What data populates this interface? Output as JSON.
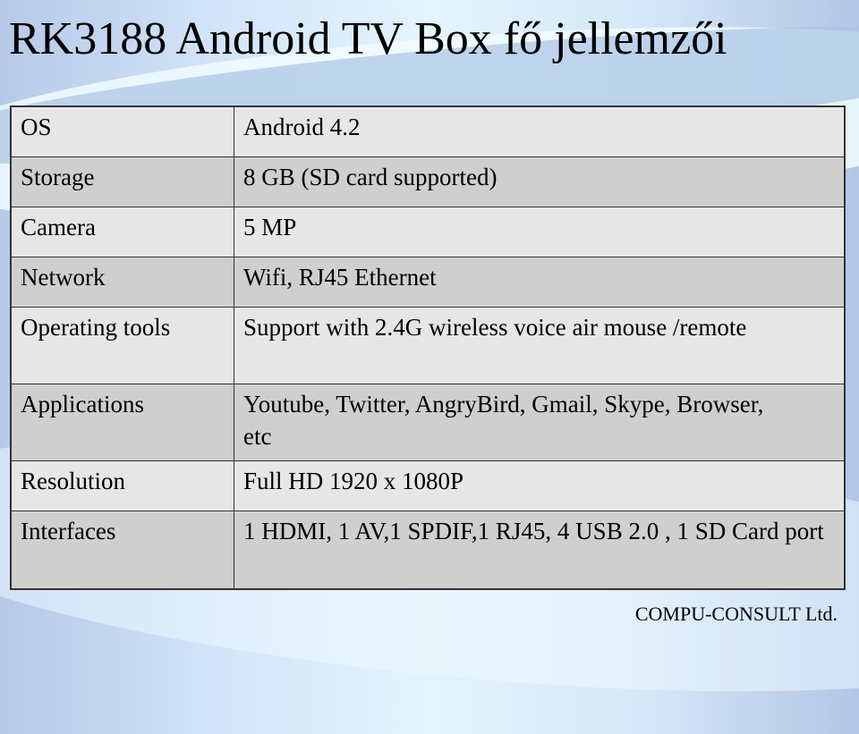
{
  "slide": {
    "title": "RK3188 Android TV Box fő jellemzői",
    "footer": "COMPU-CONSULT Ltd.",
    "colors": {
      "row_light": "#e6e6e6",
      "row_dark": "#cfcfcf",
      "border": "#333333"
    }
  },
  "specs": [
    {
      "label": "OS",
      "value": "Android 4.2"
    },
    {
      "label": "Storage",
      "value": "8 GB (SD card supported)"
    },
    {
      "label": "Camera",
      "value": "5 MP"
    },
    {
      "label": "Network",
      "value": "Wifi, RJ45 Ethernet"
    },
    {
      "label": "Operating tools",
      "value": "Support with 2.4G wireless voice air mouse /remote"
    },
    {
      "label": "Applications",
      "value": "Youtube, Twitter, AngryBird, Gmail, Skype, Browser, etc"
    },
    {
      "label": "Resolution",
      "value": "Full HD 1920 x 1080P"
    },
    {
      "label": "Interfaces",
      "value": "1 HDMI, 1 AV,1 SPDIF,1 RJ45, 4 USB 2.0 , 1 SD Card port"
    }
  ]
}
